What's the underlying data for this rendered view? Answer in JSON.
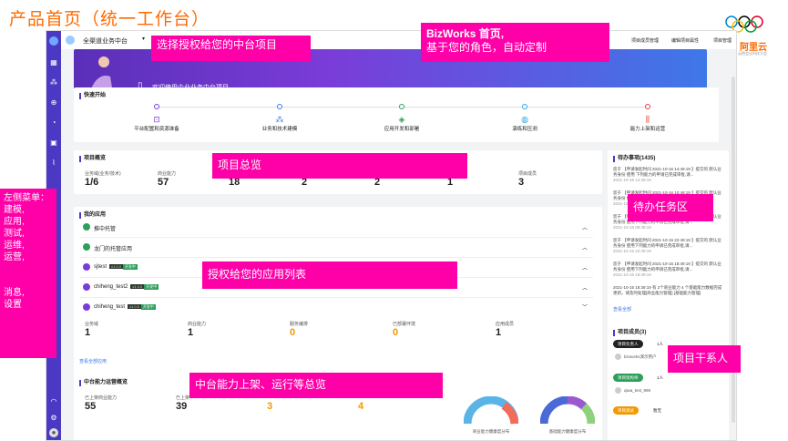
{
  "slide_title": "产品首页（统一工作台）",
  "brand": {
    "name": "阿里云",
    "sub": "云栖会议科技大会"
  },
  "topbar": {
    "workspace": "全渠道业务中台",
    "links": [
      "项目成员管理",
      "编辑项目属性",
      "项目管理"
    ]
  },
  "banner": {
    "text": "欢迎使用企业业务中台项目"
  },
  "quick_start": {
    "title": "快速开始",
    "items": [
      {
        "label": "平台配置和资源准备",
        "color": "#7a3cd8"
      },
      {
        "label": "业务和技术建模",
        "color": "#3e78e8"
      },
      {
        "label": "应用开发和部署",
        "color": "#2e9e5b"
      },
      {
        "label": "演练和压测",
        "color": "#2aa6e0"
      },
      {
        "label": "能力上架和运营",
        "color": "#e0403c"
      }
    ]
  },
  "overview": {
    "title": "项目概览",
    "stats": [
      {
        "label": "业务域(业务/技术)",
        "value": "1/6"
      },
      {
        "label": "商业能力",
        "value": "57"
      },
      {
        "label": "",
        "value": "18"
      },
      {
        "label": "",
        "value": "2"
      },
      {
        "label": "",
        "value": "2"
      },
      {
        "label": "",
        "value": "1"
      },
      {
        "label": "项目成员",
        "value": "3"
      }
    ]
  },
  "my_apps": {
    "title": "我的应用",
    "rows": [
      {
        "name": "推中托管",
        "version": "",
        "env": ""
      },
      {
        "name": "龙门的托管应用",
        "version": "",
        "env": ""
      },
      {
        "name": "sjtest",
        "version": "v1.0.0",
        "env": "开发中"
      },
      {
        "name": "chiheng_test2",
        "version": "v1.0.0",
        "env": "开发中"
      },
      {
        "name": "chiheng_test",
        "version": "v1.0.0",
        "env": "开发中"
      }
    ],
    "stats": [
      {
        "label": "业务域",
        "value": "1"
      },
      {
        "label": "商业能力",
        "value": "1"
      },
      {
        "label": "服务编排",
        "value": "0"
      },
      {
        "label": "已部署环境",
        "value": "0"
      },
      {
        "label": "应用成员",
        "value": "1"
      }
    ],
    "view_all": "查看全部应用"
  },
  "ops": {
    "title": "中台能力运营概览",
    "stats": [
      {
        "label": "已上架商业能力",
        "value": "55"
      },
      {
        "label": "已上架",
        "value": "39"
      },
      {
        "label": "",
        "value": "3"
      },
      {
        "label": "",
        "value": "4"
      }
    ],
    "donuts": [
      {
        "label": "商业能力健康度分布"
      },
      {
        "label": "基础能力健康度分布"
      }
    ]
  },
  "todo": {
    "title": "待办事项(1435)",
    "items": [
      {
        "text": "您于 【申请发起时间 2021-10-16 14:49:19 】提交的 默认业务身份 使用 下列能力的申请已完成审批,请...",
        "time": "2021-10-16 14:49:19"
      },
      {
        "text": "您于 【申请发起时间 2021-10-16 10:49:19 】提交的 默认业务身份 使用下列能力的申请已完成审批,请...",
        "time": "2021-10-16 10:49:19"
      },
      {
        "text": "您于 【申请发起时间 2021-10-16 09:49:19 】提交的 默认业务身份 使用下列能力的申请已完成审批,请...",
        "time": "2021-10-16 09:49:19"
      },
      {
        "text": "您于 【申请发起时间 2021-10-15 22:49:19 】提交的 默认业务身份 使用下列能力的申请已完成审批,请...",
        "time": "2021-10-15 22:49:19"
      },
      {
        "text": "您于 【申请发起时间 2021-10-15 18:49:19 】提交的 默认业务身份 使用下列能力的申请已完成审批,请...",
        "time": "2021-10-15 18:49:19"
      },
      {
        "text": "2021-10-15 18:39:19 有 2个商业能力 4 个基础能力数据完成更新，请及时处理[商业能力管理] [基础能力管理]",
        "time": "2021-10-15 18:39:19"
      }
    ],
    "view_all": "查看全部"
  },
  "members": {
    "title": "项目成员(3)",
    "groups": [
      {
        "role": "项目负责人",
        "count": "1人",
        "color": "#222",
        "user": "bizworks演示用户"
      },
      {
        "role": "项目架构师",
        "count": "1人",
        "color": "#2e9e5b",
        "user": "qiwa_test_999"
      },
      {
        "role": "项目测试",
        "count": "暂无",
        "color": "#f29900",
        "user": ""
      }
    ]
  },
  "annotations": {
    "select_project": "选择授权给您的中台项目",
    "bizworks_home_1": "BizWorks 首页,",
    "bizworks_home_2": "基于您的角色，自动定制",
    "overview": "项目总览",
    "todo": "待办任务区",
    "app_list": "授权给您的应用列表",
    "members": "项目干系人",
    "ops": "中台能力上架、运行等总览",
    "left_menu": "左侧菜单：\n建模,\n应用,\n测试,\n运维,\n运营,\n\n\n消息,\n设置"
  }
}
